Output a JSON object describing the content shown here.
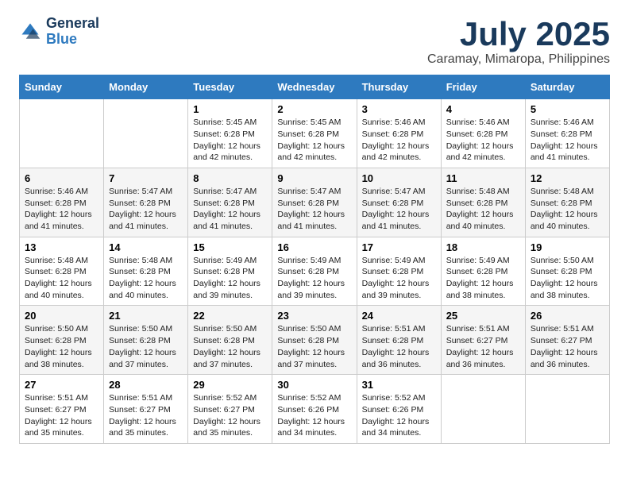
{
  "header": {
    "logo_general": "General",
    "logo_blue": "Blue",
    "title": "July 2025",
    "subtitle": "Caramay, Mimaropa, Philippines"
  },
  "days_of_week": [
    "Sunday",
    "Monday",
    "Tuesday",
    "Wednesday",
    "Thursday",
    "Friday",
    "Saturday"
  ],
  "weeks": [
    [
      {
        "day": "",
        "info": ""
      },
      {
        "day": "",
        "info": ""
      },
      {
        "day": "1",
        "info": "Sunrise: 5:45 AM\nSunset: 6:28 PM\nDaylight: 12 hours and 42 minutes."
      },
      {
        "day": "2",
        "info": "Sunrise: 5:45 AM\nSunset: 6:28 PM\nDaylight: 12 hours and 42 minutes."
      },
      {
        "day": "3",
        "info": "Sunrise: 5:46 AM\nSunset: 6:28 PM\nDaylight: 12 hours and 42 minutes."
      },
      {
        "day": "4",
        "info": "Sunrise: 5:46 AM\nSunset: 6:28 PM\nDaylight: 12 hours and 42 minutes."
      },
      {
        "day": "5",
        "info": "Sunrise: 5:46 AM\nSunset: 6:28 PM\nDaylight: 12 hours and 41 minutes."
      }
    ],
    [
      {
        "day": "6",
        "info": "Sunrise: 5:46 AM\nSunset: 6:28 PM\nDaylight: 12 hours and 41 minutes."
      },
      {
        "day": "7",
        "info": "Sunrise: 5:47 AM\nSunset: 6:28 PM\nDaylight: 12 hours and 41 minutes."
      },
      {
        "day": "8",
        "info": "Sunrise: 5:47 AM\nSunset: 6:28 PM\nDaylight: 12 hours and 41 minutes."
      },
      {
        "day": "9",
        "info": "Sunrise: 5:47 AM\nSunset: 6:28 PM\nDaylight: 12 hours and 41 minutes."
      },
      {
        "day": "10",
        "info": "Sunrise: 5:47 AM\nSunset: 6:28 PM\nDaylight: 12 hours and 41 minutes."
      },
      {
        "day": "11",
        "info": "Sunrise: 5:48 AM\nSunset: 6:28 PM\nDaylight: 12 hours and 40 minutes."
      },
      {
        "day": "12",
        "info": "Sunrise: 5:48 AM\nSunset: 6:28 PM\nDaylight: 12 hours and 40 minutes."
      }
    ],
    [
      {
        "day": "13",
        "info": "Sunrise: 5:48 AM\nSunset: 6:28 PM\nDaylight: 12 hours and 40 minutes."
      },
      {
        "day": "14",
        "info": "Sunrise: 5:48 AM\nSunset: 6:28 PM\nDaylight: 12 hours and 40 minutes."
      },
      {
        "day": "15",
        "info": "Sunrise: 5:49 AM\nSunset: 6:28 PM\nDaylight: 12 hours and 39 minutes."
      },
      {
        "day": "16",
        "info": "Sunrise: 5:49 AM\nSunset: 6:28 PM\nDaylight: 12 hours and 39 minutes."
      },
      {
        "day": "17",
        "info": "Sunrise: 5:49 AM\nSunset: 6:28 PM\nDaylight: 12 hours and 39 minutes."
      },
      {
        "day": "18",
        "info": "Sunrise: 5:49 AM\nSunset: 6:28 PM\nDaylight: 12 hours and 38 minutes."
      },
      {
        "day": "19",
        "info": "Sunrise: 5:50 AM\nSunset: 6:28 PM\nDaylight: 12 hours and 38 minutes."
      }
    ],
    [
      {
        "day": "20",
        "info": "Sunrise: 5:50 AM\nSunset: 6:28 PM\nDaylight: 12 hours and 38 minutes."
      },
      {
        "day": "21",
        "info": "Sunrise: 5:50 AM\nSunset: 6:28 PM\nDaylight: 12 hours and 37 minutes."
      },
      {
        "day": "22",
        "info": "Sunrise: 5:50 AM\nSunset: 6:28 PM\nDaylight: 12 hours and 37 minutes."
      },
      {
        "day": "23",
        "info": "Sunrise: 5:50 AM\nSunset: 6:28 PM\nDaylight: 12 hours and 37 minutes."
      },
      {
        "day": "24",
        "info": "Sunrise: 5:51 AM\nSunset: 6:28 PM\nDaylight: 12 hours and 36 minutes."
      },
      {
        "day": "25",
        "info": "Sunrise: 5:51 AM\nSunset: 6:27 PM\nDaylight: 12 hours and 36 minutes."
      },
      {
        "day": "26",
        "info": "Sunrise: 5:51 AM\nSunset: 6:27 PM\nDaylight: 12 hours and 36 minutes."
      }
    ],
    [
      {
        "day": "27",
        "info": "Sunrise: 5:51 AM\nSunset: 6:27 PM\nDaylight: 12 hours and 35 minutes."
      },
      {
        "day": "28",
        "info": "Sunrise: 5:51 AM\nSunset: 6:27 PM\nDaylight: 12 hours and 35 minutes."
      },
      {
        "day": "29",
        "info": "Sunrise: 5:52 AM\nSunset: 6:27 PM\nDaylight: 12 hours and 35 minutes."
      },
      {
        "day": "30",
        "info": "Sunrise: 5:52 AM\nSunset: 6:26 PM\nDaylight: 12 hours and 34 minutes."
      },
      {
        "day": "31",
        "info": "Sunrise: 5:52 AM\nSunset: 6:26 PM\nDaylight: 12 hours and 34 minutes."
      },
      {
        "day": "",
        "info": ""
      },
      {
        "day": "",
        "info": ""
      }
    ]
  ]
}
